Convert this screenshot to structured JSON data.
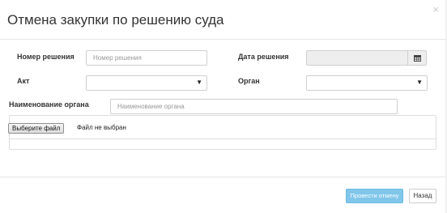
{
  "modal": {
    "title": "Отмена закупки по решению суда",
    "close_glyph": "×"
  },
  "form": {
    "decision_number": {
      "label": "Номер решения",
      "value": "",
      "placeholder": "Номер решения"
    },
    "decision_date": {
      "label": "Дата решения",
      "value": "",
      "icon": "calendar-icon"
    },
    "act": {
      "label": "Акт",
      "selected": ""
    },
    "organ": {
      "label": "Орган",
      "selected": ""
    },
    "organ_name": {
      "label": "Наименование органа",
      "value": "",
      "placeholder": "Наименование органа"
    },
    "file": {
      "button_label": "Выберите файл",
      "status": "Файл не выбран"
    }
  },
  "footer": {
    "submit_label": "Провести отмену",
    "back_label": "Назад",
    "accent_color": "#7fc6ea"
  }
}
